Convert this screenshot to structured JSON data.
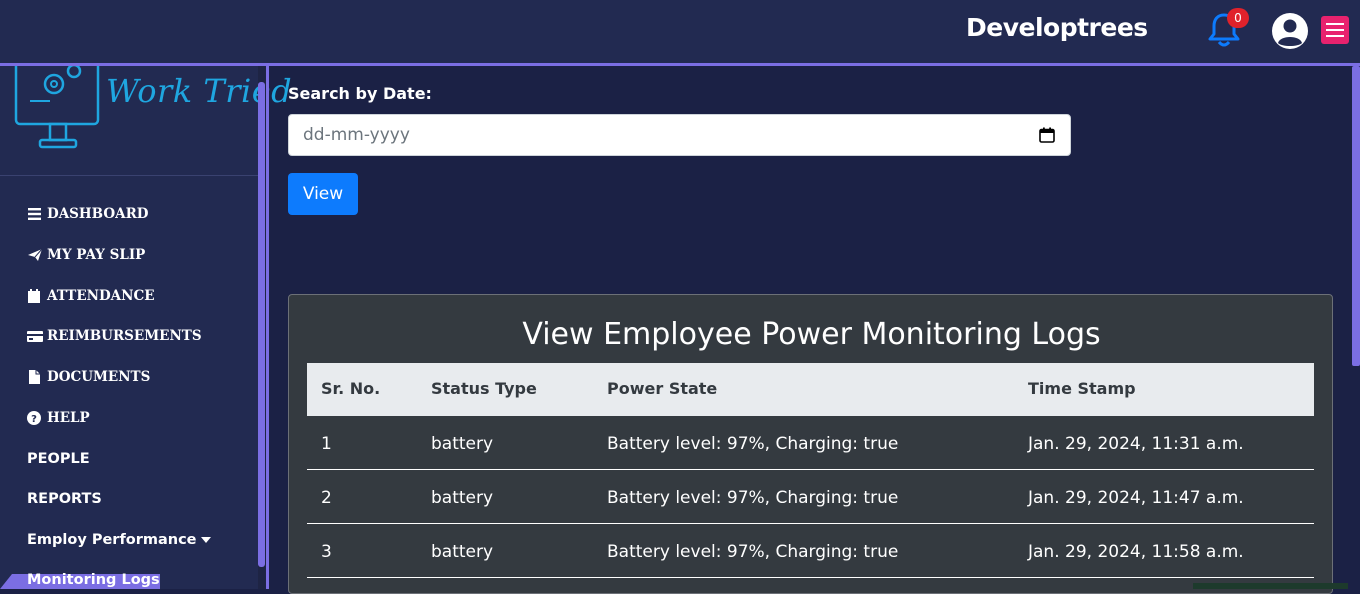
{
  "header": {
    "brand": "Developtrees",
    "notification_count": "0",
    "colors": {
      "bar": "#222a51",
      "accent": "#7b6ee3",
      "bell": "#0d7bfd",
      "badge": "#e0222b",
      "menu": "#e8226e"
    }
  },
  "sidebar": {
    "logo_text": "Work Tried",
    "items": [
      {
        "label": "DASHBOARD",
        "icon": "bars-icon"
      },
      {
        "label": "MY PAY SLIP",
        "icon": "paper-plane-icon"
      },
      {
        "label": "ATTENDANCE",
        "icon": "calendar-icon"
      },
      {
        "label": "REIMBURSEMENTS",
        "icon": "credit-card-icon"
      },
      {
        "label": "DOCUMENTS",
        "icon": "file-icon"
      },
      {
        "label": "HELP",
        "icon": "question-circle-icon"
      },
      {
        "label": "PEOPLE"
      },
      {
        "label": "REPORTS"
      },
      {
        "label": "Employ Performance",
        "icon": "caret-down-icon"
      },
      {
        "label": "Monitoring Logs",
        "active": true
      }
    ]
  },
  "search": {
    "label": "Search by Date:",
    "placeholder": "dd-mm-yyyy",
    "button_label": "View"
  },
  "logs": {
    "title": "View Employee Power Monitoring Logs",
    "columns": [
      "Sr. No.",
      "Status Type",
      "Power State",
      "Time Stamp"
    ],
    "rows": [
      [
        "1",
        "battery",
        "Battery level: 97%, Charging: true",
        "Jan. 29, 2024, 11:31 a.m."
      ],
      [
        "2",
        "battery",
        "Battery level: 97%, Charging: true",
        "Jan. 29, 2024, 11:47 a.m."
      ],
      [
        "3",
        "battery",
        "Battery level: 97%, Charging: true",
        "Jan. 29, 2024, 11:58 a.m."
      ]
    ]
  }
}
